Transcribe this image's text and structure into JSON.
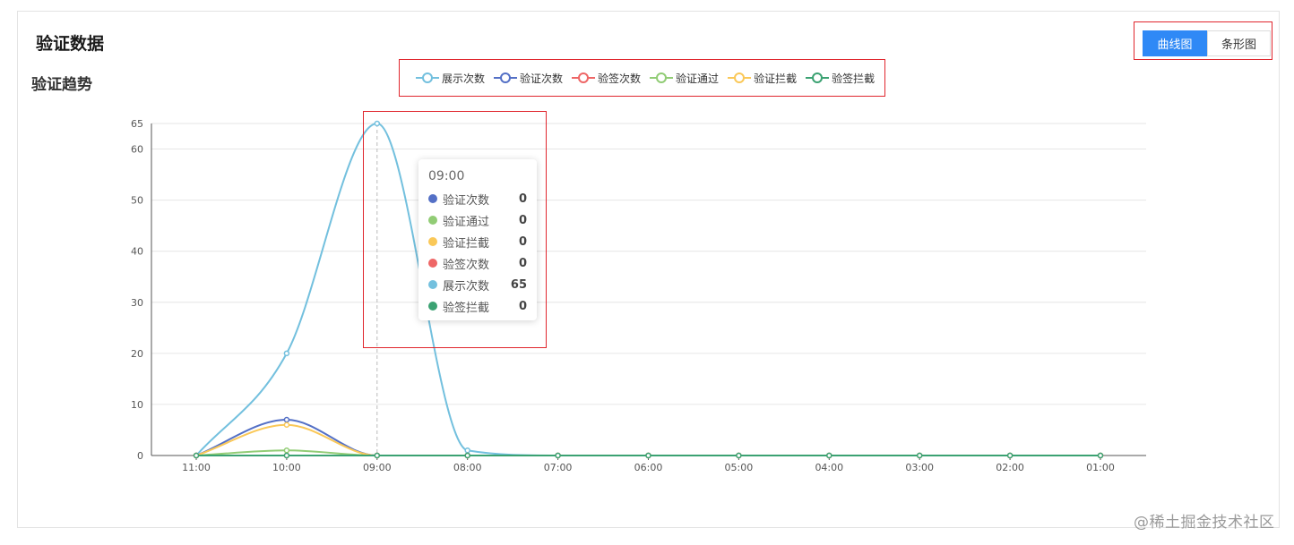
{
  "header": {
    "title": "验证数据",
    "section_title": "验证趋势"
  },
  "view_switch": {
    "line_label": "曲线图",
    "bar_label": "条形图"
  },
  "tooltip": {
    "title": "09:00",
    "rows": [
      {
        "name": "验证次数",
        "value": "0",
        "color": "#5470c6"
      },
      {
        "name": "验证通过",
        "value": "0",
        "color": "#91cc75"
      },
      {
        "name": "验证拦截",
        "value": "0",
        "color": "#fac858"
      },
      {
        "name": "验签次数",
        "value": "0",
        "color": "#ee6666"
      },
      {
        "name": "展示次数",
        "value": "65",
        "color": "#73c0de"
      },
      {
        "name": "验签拦截",
        "value": "0",
        "color": "#3ba272"
      }
    ]
  },
  "watermark": "@稀土掘金技术社区",
  "chart_data": {
    "type": "line",
    "smooth": true,
    "categories": [
      "11:00",
      "10:00",
      "09:00",
      "08:00",
      "07:00",
      "06:00",
      "05:00",
      "04:00",
      "03:00",
      "02:00",
      "01:00"
    ],
    "yticks": [
      0,
      10,
      20,
      30,
      40,
      50,
      60,
      65
    ],
    "ylim": [
      0,
      65
    ],
    "grid": "horizontal",
    "legend_position": "top-center",
    "highlight_category": "09:00",
    "series": [
      {
        "name": "展示次数",
        "color": "#73c0de",
        "values": [
          0,
          20,
          65,
          1,
          0,
          0,
          0,
          0,
          0,
          0,
          0
        ]
      },
      {
        "name": "验证次数",
        "color": "#5470c6",
        "values": [
          0,
          7,
          0,
          0,
          0,
          0,
          0,
          0,
          0,
          0,
          0
        ]
      },
      {
        "name": "验签次数",
        "color": "#ee6666",
        "values": [
          0,
          0,
          0,
          0,
          0,
          0,
          0,
          0,
          0,
          0,
          0
        ]
      },
      {
        "name": "验证通过",
        "color": "#91cc75",
        "values": [
          0,
          1,
          0,
          0,
          0,
          0,
          0,
          0,
          0,
          0,
          0
        ]
      },
      {
        "name": "验证拦截",
        "color": "#fac858",
        "values": [
          0,
          6,
          0,
          0,
          0,
          0,
          0,
          0,
          0,
          0,
          0
        ]
      },
      {
        "name": "验签拦截",
        "color": "#3ba272",
        "values": [
          0,
          0,
          0,
          0,
          0,
          0,
          0,
          0,
          0,
          0,
          0
        ]
      }
    ]
  }
}
